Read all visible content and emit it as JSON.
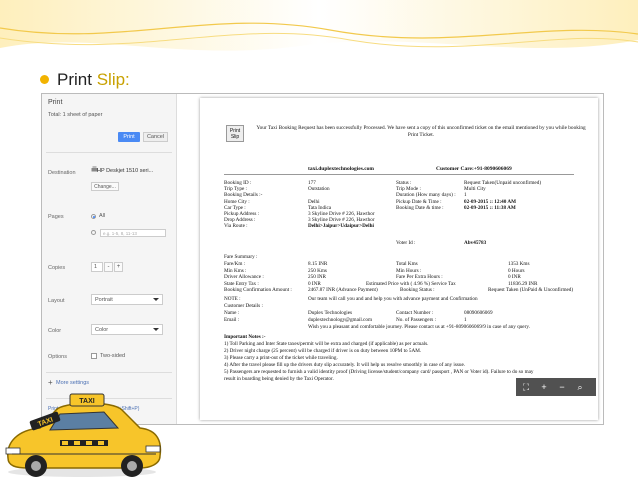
{
  "slide": {
    "bullet_text": "Print",
    "accent_text": "Slip:"
  },
  "print_panel": {
    "title": "Print",
    "total": "Total: 1 sheet of paper",
    "print_button": "Print",
    "cancel_button": "Cancel",
    "destination_label": "Destination",
    "destination_value": "HP Deskjet 1510 seri...",
    "change_button": "Change...",
    "pages_label": "Pages",
    "pages_all": "All",
    "pages_placeholder": "e.g. 1-5, 8, 11-13",
    "copies_label": "Copies",
    "copies_value": "1",
    "layout_label": "Layout",
    "layout_value": "Portrait",
    "color_label": "Color",
    "color_value": "Color",
    "options_label": "Options",
    "two_sided": "Two-sided",
    "more_settings": "More settings",
    "system_dialog": "Print using system dialog... (Ctrl+Shift+P)"
  },
  "ticket": {
    "print_button": "Print Slip",
    "message": "Your Taxi Booking Request has been successfully Processed. We have sent a copy of this unconfirmed ticket on the email mentioned by you while booking Print Ticket.",
    "site": "taxi.duplextechnologies.com",
    "customer_care": "Customer Care:+91-8090606069",
    "left_rows": [
      [
        "Booking ID :",
        "177"
      ],
      [
        "Trip Type :",
        "Outstation"
      ],
      [
        "Booking Details :-",
        ""
      ],
      [
        "Home City :",
        "Delhi"
      ],
      [
        "Car Type :",
        "Tata Indica"
      ],
      [
        "Pickup Address :",
        "3 Skyline Drive # 226, Hawthor"
      ],
      [
        "Drop Address :",
        "3 Skyline Drive # 226, Hawthor"
      ],
      [
        "Via Route :",
        "Delhi>Jaipur>Udaipur>Delhi"
      ]
    ],
    "right_rows": [
      [
        "Status :",
        "Request Taken(Unpaid unconfirmed)"
      ],
      [
        "Trip Mode :",
        "Multi City"
      ],
      [
        "Duration (How many days) :",
        "1"
      ],
      [
        "Pickup Date & Time :",
        "02-09-2015 :: 12:40 AM"
      ],
      [
        "Booking Date & time :",
        "02-09-2015 :: 11:38 AM"
      ]
    ],
    "voter_label": "Voter Id :",
    "voter_value": "Abv45783",
    "fare_summary": "Fare Summary :",
    "fare_left": [
      [
        "Fare/Km :",
        "8.15 INR"
      ],
      [
        "Min Kms :",
        "250 Kms"
      ],
      [
        "Driver Allowance :",
        "250 INR"
      ],
      [
        "State Entry Tax :",
        "0 INR"
      ],
      [
        "Booking Confirmation Amount :",
        "2467.87 INR (Advance Payment)"
      ]
    ],
    "fare_right": [
      [
        "Total Kms",
        "1353 Kms"
      ],
      [
        "Min Hours :",
        "0 Hours"
      ],
      [
        "Fare Per Extra Hours :",
        "0 INR"
      ],
      [
        "Estimated Price with ( 4.96 %) Service Tax",
        "11836.29 INR"
      ],
      [
        "Booking Status :",
        "Request Taken (UnPaid & Unconfirmed)"
      ]
    ],
    "note": "NOTE :",
    "note_text": "Our team will call you and and help you with advance payment and Confirmation",
    "customer_details": "Customer Details :",
    "name_label": "Name :",
    "name_value": "Duplex Technologies",
    "contact_label": "Contact Number :",
    "contact_value": "08090606069",
    "email_label": "Email :",
    "email_value": "duplextechnology@gmail.com",
    "passengers_label": "No. of Passengers :",
    "passengers_value": "1",
    "wish": "Wish you a pleasant and comfortable journey. Please contact us at +91-8090606069/9 in case of any query.",
    "notes_title": "Important Notes :-",
    "notes": [
      "1) Toll Parking and Inter State taxes/permit will be extra and charged (if applicable) as per actuals.",
      "2) Driver night charge (25 percent) will be charged if driver is on duty between 10PM to 5AM.",
      "3) Please carry a print-out of the ticket while traveling.",
      "4) After the travel please fill up the drivers duty slip accurately. It will help us resolve smoothly in case of any issue.",
      "5) Passengers are requested to furnish a valid identity proof (Driving license/student/company card/ passport , PAN or Voter id). Failure to do so may",
      "result in boarding being denied by the Taxi Operator."
    ]
  },
  "taxi_sign": "TAXI",
  "colors": {
    "accent": "#f2b300",
    "print_blue": "#4a8af4"
  },
  "icons": [
    "fit-page-icon",
    "zoom-in-icon",
    "zoom-out-icon",
    "zoom-icon"
  ]
}
